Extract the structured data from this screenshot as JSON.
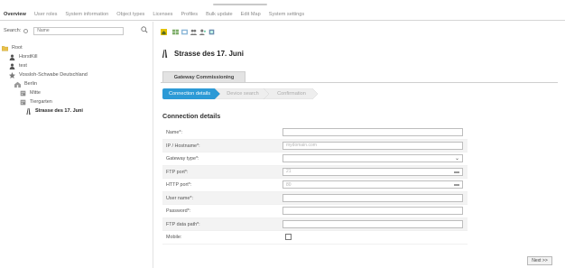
{
  "topnav": {
    "tabs": [
      {
        "label": "Overview",
        "active": true
      },
      {
        "label": "User roles",
        "active": false
      },
      {
        "label": "System information",
        "active": false
      },
      {
        "label": "Object types",
        "active": false
      },
      {
        "label": "Licenses",
        "active": false
      },
      {
        "label": "Profiles",
        "active": false
      },
      {
        "label": "Bulk update",
        "active": false
      },
      {
        "label": "Edit Map",
        "active": false
      },
      {
        "label": "System settings",
        "active": false
      }
    ]
  },
  "search": {
    "label": "Search:",
    "placeholder": "Name"
  },
  "tree": {
    "items": [
      {
        "label": "Root",
        "icon": "folder-icon"
      },
      {
        "label": "HorstKill",
        "icon": "user-icon"
      },
      {
        "label": "test",
        "icon": "user-icon"
      },
      {
        "label": "Vossloh-Schwabe Deutschland",
        "icon": "company-icon"
      },
      {
        "label": "Berlin",
        "icon": "building-icon"
      },
      {
        "label": "Mitte",
        "icon": "district-icon"
      },
      {
        "label": "Tiergarten",
        "icon": "district-icon"
      },
      {
        "label": "Strasse des 17. Juni",
        "icon": "street-icon",
        "selected": true
      }
    ]
  },
  "page": {
    "title": "Strasse des 17. Juni",
    "section_tab": "Gateway Commissioning",
    "wizard_steps": [
      {
        "label": "Connection details",
        "active": true
      },
      {
        "label": "Device search",
        "active": false
      },
      {
        "label": "Confirmation",
        "active": false
      }
    ],
    "heading": "Connection details"
  },
  "form": {
    "fields": [
      {
        "label": "Name*:",
        "value": "",
        "type": "text"
      },
      {
        "label": "IP / Hostname*:",
        "value": "mydomain.com",
        "type": "text"
      },
      {
        "label": "Gateway type*:",
        "value": "",
        "type": "select"
      },
      {
        "label": "FTP port*:",
        "value": "21",
        "type": "number"
      },
      {
        "label": "HTTP port*:",
        "value": "80",
        "type": "number"
      },
      {
        "label": "User name*:",
        "value": "",
        "type": "text"
      },
      {
        "label": "Password*:",
        "value": "",
        "type": "text"
      },
      {
        "label": "FTP data path*:",
        "value": "",
        "type": "text"
      },
      {
        "label": "Mobile:",
        "value": "",
        "type": "checkbox"
      }
    ]
  },
  "buttons": {
    "next": "Next >>"
  },
  "colors": {
    "wizard_active": "#2c9ad6",
    "wizard_inactive": "#eeeeee",
    "section_tab_bg": "#e3e3e3"
  }
}
